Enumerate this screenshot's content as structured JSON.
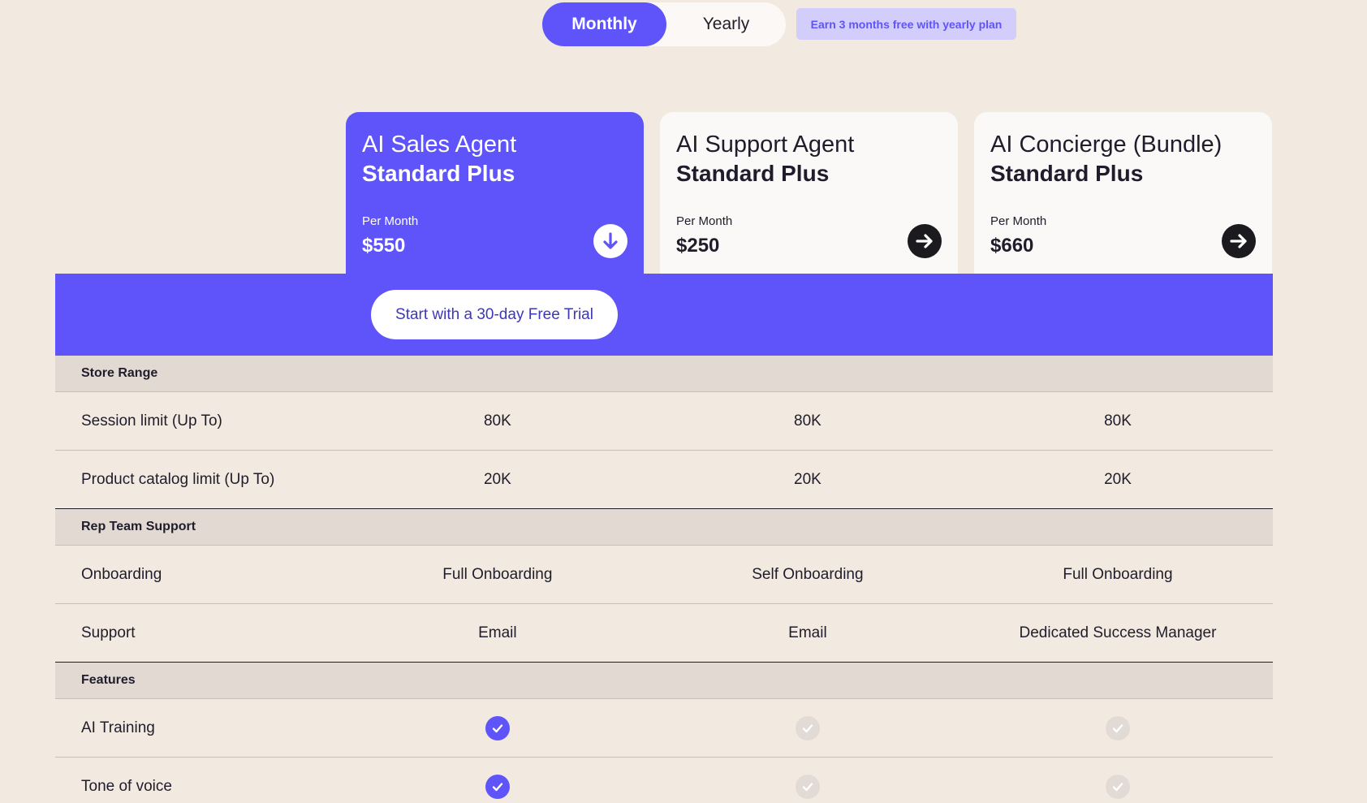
{
  "billing": {
    "monthly_label": "Monthly",
    "yearly_label": "Yearly",
    "promo": "Earn 3 months free with yearly plan"
  },
  "plans": [
    {
      "title": "AI Sales Agent",
      "tier": "Standard Plus",
      "period": "Per Month",
      "price": "$550",
      "action_icon": "arrow-down-icon"
    },
    {
      "title": "AI Support Agent",
      "tier": "Standard Plus",
      "period": "Per Month",
      "price": "$250",
      "action_icon": "arrow-right-icon"
    },
    {
      "title": "AI Concierge (Bundle)",
      "tier": "Standard Plus",
      "period": "Per Month",
      "price": "$660",
      "action_icon": "arrow-right-icon"
    }
  ],
  "trial_button": "Start with a 30-day Free Trial",
  "sections": {
    "store_range": {
      "title": "Store Range",
      "rows": [
        {
          "label": "Session limit (Up To)",
          "values": [
            "80K",
            "80K",
            "80K"
          ]
        },
        {
          "label": "Product catalog limit (Up To)",
          "values": [
            "20K",
            "20K",
            "20K"
          ]
        }
      ]
    },
    "rep_team": {
      "title": "Rep Team Support",
      "rows": [
        {
          "label": "Onboarding",
          "values": [
            "Full Onboarding",
            "Self Onboarding",
            "Full Onboarding"
          ]
        },
        {
          "label": "Support",
          "values": [
            "Email",
            "Email",
            "Dedicated Success Manager"
          ]
        }
      ]
    },
    "features": {
      "title": "Features",
      "rows": [
        {
          "label": "AI Training",
          "included": [
            true,
            false,
            false
          ]
        },
        {
          "label": "Tone of voice",
          "included": [
            true,
            false,
            false
          ]
        }
      ]
    }
  },
  "colors": {
    "accent": "#5f54fa",
    "background": "#f2e9e0",
    "section_header": "#e3d9d3",
    "check_off": "#e2dbd5"
  }
}
